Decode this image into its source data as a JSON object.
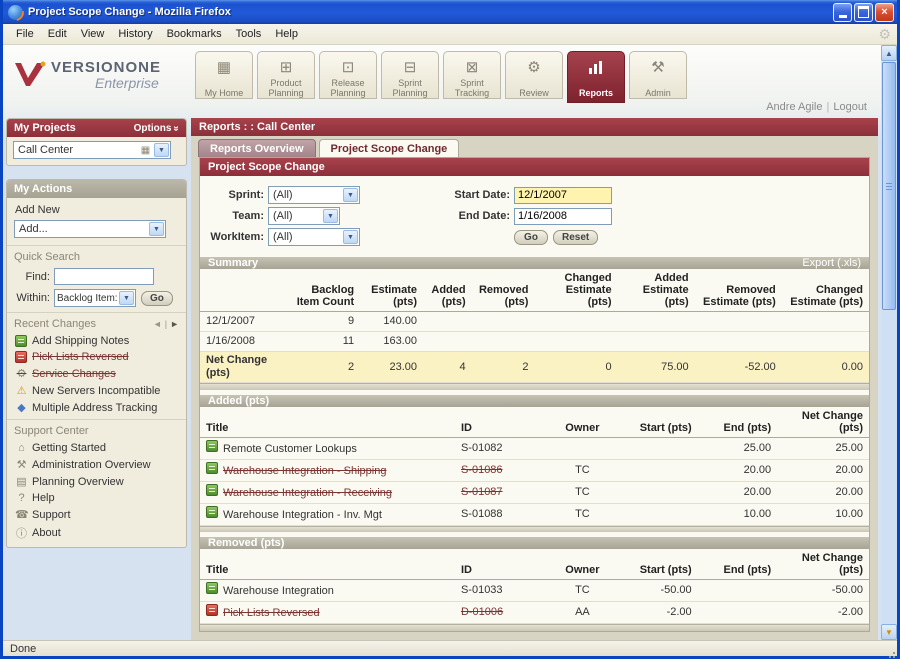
{
  "window": {
    "title": "Project Scope Change - Mozilla Firefox",
    "menus": [
      "File",
      "Edit",
      "View",
      "History",
      "Bookmarks",
      "Tools",
      "Help"
    ],
    "status": "Done"
  },
  "header": {
    "brand_line1": "VERSIONONE",
    "brand_line2": "Enterprise",
    "nav": [
      {
        "label": "My Home",
        "icon": "grid-icon",
        "active": false
      },
      {
        "label": "Product Planning",
        "icon": "org-icon",
        "active": false
      },
      {
        "label": "Release Planning",
        "icon": "release-doc-icon",
        "active": false
      },
      {
        "label": "Sprint Planning",
        "icon": "sprint-doc-icon",
        "active": false
      },
      {
        "label": "Sprint Tracking",
        "icon": "box-icon",
        "active": false
      },
      {
        "label": "Review",
        "icon": "gear-icon",
        "active": false
      },
      {
        "label": "Reports",
        "icon": "chart-icon",
        "active": true
      },
      {
        "label": "Admin",
        "icon": "wrench-icon",
        "active": false
      }
    ],
    "user": "Andre Agile",
    "logout": "Logout"
  },
  "sidebar": {
    "projects": {
      "title": "My Projects",
      "options_label": "Options",
      "selected_project": "Call Center"
    },
    "actions": {
      "title": "My Actions",
      "add_new_label": "Add New",
      "add_value": "Add..."
    },
    "quick_search": {
      "title": "Quick Search",
      "find_label": "Find:",
      "find_value": "",
      "within_label": "Within:",
      "within_value": "Backlog Item:",
      "go_label": "Go"
    },
    "recent_changes": {
      "title": "Recent Changes",
      "items": [
        {
          "label": "Add Shipping Notes",
          "icon": "story-icon",
          "struck": false
        },
        {
          "label": "Pick Lists Reversed",
          "icon": "defect-icon",
          "struck": true
        },
        {
          "label": "Service Changes",
          "icon": "gear-icon",
          "struck": true
        },
        {
          "label": "New Servers Incompatible",
          "icon": "warning-icon",
          "struck": false
        },
        {
          "label": "Multiple Address Tracking",
          "icon": "diamond-icon",
          "struck": false
        }
      ]
    },
    "support": {
      "title": "Support Center",
      "items": [
        {
          "label": "Getting Started",
          "icon": "home-icon"
        },
        {
          "label": "Administration Overview",
          "icon": "tools-icon"
        },
        {
          "label": "Planning Overview",
          "icon": "planning-icon"
        },
        {
          "label": "Help",
          "icon": "help-icon"
        },
        {
          "label": "Support",
          "icon": "phone-icon"
        },
        {
          "label": "About",
          "icon": "info-icon"
        }
      ]
    }
  },
  "main": {
    "breadcrumb": "Reports : : Call Center",
    "tabs": [
      {
        "label": "Reports Overview",
        "active": false
      },
      {
        "label": "Project Scope Change",
        "active": true
      }
    ],
    "report_title": "Project Scope Change",
    "filters": {
      "sprint_label": "Sprint:",
      "sprint_value": "(All)",
      "team_label": "Team:",
      "team_value": "(All)",
      "workitem_label": "WorkItem:",
      "workitem_value": "(All)",
      "start_label": "Start Date:",
      "start_value": "12/1/2007",
      "end_label": "End Date:",
      "end_value": "1/16/2008",
      "go_label": "Go",
      "reset_label": "Reset"
    },
    "summary": {
      "title": "Summary",
      "export_label": "Export (.xls)",
      "columns": [
        "",
        "Backlog Item Count",
        "Estimate (pts)",
        "Added (pts)",
        "Removed (pts)",
        "Changed Estimate (pts)",
        "Added Estimate (pts)",
        "Removed Estimate (pts)",
        "Changed Estimate (pts)"
      ],
      "rows": [
        {
          "label": "12/1/2007",
          "values": [
            "9",
            "140.00",
            "",
            "",
            "",
            "",
            "",
            ""
          ]
        },
        {
          "label": "1/16/2008",
          "values": [
            "11",
            "163.00",
            "",
            "",
            "",
            "",
            "",
            ""
          ]
        },
        {
          "label": "Net Change (pts)",
          "values": [
            "2",
            "23.00",
            "4",
            "2",
            "0",
            "75.00",
            "-52.00",
            "0.00"
          ]
        }
      ]
    },
    "added": {
      "title": "Added (pts)",
      "columns": [
        "Title",
        "ID",
        "Owner",
        "Start (pts)",
        "End (pts)",
        "Net Change (pts)"
      ],
      "rows": [
        {
          "icon": "story-icon",
          "title": "Remote Customer Lookups",
          "id": "S-01082",
          "owner": "",
          "start": "",
          "end": "25.00",
          "net": "25.00",
          "struck": false
        },
        {
          "icon": "story-icon",
          "title": "Warehouse Integration - Shipping",
          "id": "S-01086",
          "owner": "TC",
          "start": "",
          "end": "20.00",
          "net": "20.00",
          "struck": true
        },
        {
          "icon": "story-icon",
          "title": "Warehouse Integration - Receiving",
          "id": "S-01087",
          "owner": "TC",
          "start": "",
          "end": "20.00",
          "net": "20.00",
          "struck": true
        },
        {
          "icon": "story-icon",
          "title": "Warehouse Integration - Inv. Mgt",
          "id": "S-01088",
          "owner": "TC",
          "start": "",
          "end": "10.00",
          "net": "10.00",
          "struck": false
        }
      ]
    },
    "removed": {
      "title": "Removed (pts)",
      "columns": [
        "Title",
        "ID",
        "Owner",
        "Start (pts)",
        "End (pts)",
        "Net Change (pts)"
      ],
      "rows": [
        {
          "icon": "story-icon",
          "title": "Warehouse Integration",
          "id": "S-01033",
          "owner": "TC",
          "start": "-50.00",
          "end": "",
          "net": "-50.00",
          "struck": false
        },
        {
          "icon": "defect-icon",
          "title": "Pick Lists Reversed",
          "id": "D-01006",
          "owner": "AA",
          "start": "-2.00",
          "end": "",
          "net": "-2.00",
          "struck": true
        }
      ]
    }
  }
}
